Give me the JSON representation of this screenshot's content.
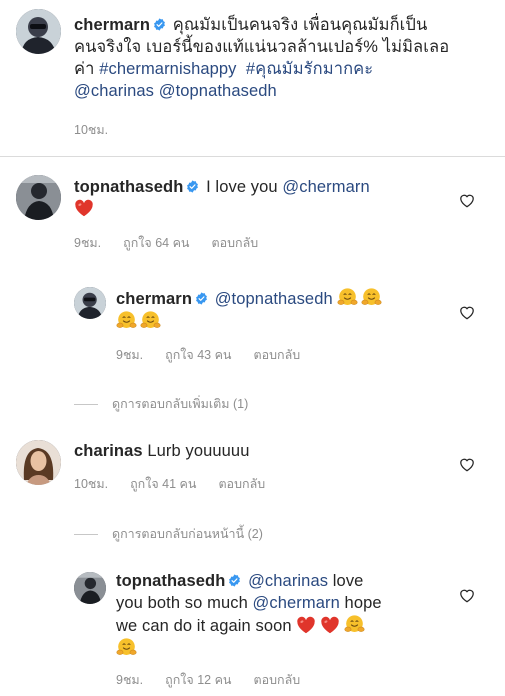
{
  "caption": {
    "username": "chermarn",
    "text_line1": "คุณมัมเป็นคนจริง เพื่อนคุณมัมก็เป็น",
    "text_line2": "คนจริงใจ เบอร์นี้ของแท้แน่นวลล้านเปอร์% ไม่มิลเลอ",
    "text_prefix3": "ค่า ",
    "hashtag1": "#chermarnishappy",
    "hashtag2": "#คุณมัมรักมากคะ",
    "mention1": "@charinas",
    "mention2": "@topnathasedh",
    "time": "10ชม."
  },
  "comments": [
    {
      "username": "topnathasedh",
      "text": "I love you",
      "mention": "@chermarn",
      "time": "9ชม.",
      "likes": "ถูกใจ 64 คน",
      "reply_label": "ตอบกลับ"
    },
    {
      "username": "chermarn",
      "mention": "@topnathasedh",
      "time": "9ชม.",
      "likes": "ถูกใจ 43 คน",
      "reply_label": "ตอบกลับ"
    },
    {
      "username": "charinas",
      "text": "Lurb youuuuu",
      "time": "10ชม.",
      "likes": "ถูกใจ 41 คน",
      "reply_label": "ตอบกลับ"
    },
    {
      "username": "topnathasedh",
      "mention1": "@charinas",
      "text1": " love",
      "text2": "you both so much ",
      "mention2": "@chermarn",
      "text3": " hope",
      "text4": "we can do it again soon ",
      "time": "9ชม.",
      "likes": "ถูกใจ 12 คน",
      "reply_label": "ตอบกลับ"
    }
  ],
  "view_more_replies": "ดูการตอบกลับเพิ่มเติม (1)",
  "view_previous_replies": "ดูการตอบกลับก่อนหน้านี้ (2)",
  "icons": [
    "verified-badge-icon",
    "heart-outline-icon",
    "hugging-face-emoji",
    "red-heart-emoji"
  ],
  "colors": {
    "link": "#2b4a80",
    "meta": "#8e8e8e",
    "verified": "#3897f0",
    "heart": "#ed4956",
    "emoji": "#f7c02b"
  }
}
